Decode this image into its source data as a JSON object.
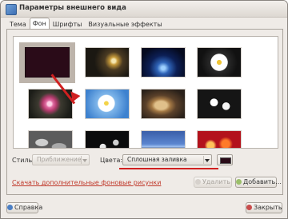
{
  "window": {
    "title": "Параметры внешнего вида"
  },
  "tabs": [
    {
      "label": "Тема",
      "active": false
    },
    {
      "label": "Фон",
      "active": true
    },
    {
      "label": "Шрифты",
      "active": false
    },
    {
      "label": "Визуальные эффекты",
      "active": false
    }
  ],
  "wallpapers": [
    {
      "name": "solid-fill",
      "selected": true
    },
    {
      "name": "lamp-bokeh"
    },
    {
      "name": "night-road"
    },
    {
      "name": "white-daisy"
    },
    {
      "name": "pink-flower"
    },
    {
      "name": "daisy-on-blue"
    },
    {
      "name": "autumn-leaf"
    },
    {
      "name": "white-flowers"
    },
    {
      "name": "pebbles"
    },
    {
      "name": "dark-flowers"
    },
    {
      "name": "city-lights"
    },
    {
      "name": "red-bokeh"
    }
  ],
  "style": {
    "label": "Стиль:",
    "value": "Приближение",
    "disabled": true
  },
  "colors": {
    "label": "Цвета:",
    "value": "Сплошная заливка",
    "swatch": "#2a0b18"
  },
  "download_link": "Скачать дополнительные фоновые рисунки",
  "buttons": {
    "remove": "Удалить",
    "add": "Добавить...",
    "help": "Справка",
    "close": "Закрыть"
  },
  "accents": {
    "annotation_red": "#d02020"
  }
}
